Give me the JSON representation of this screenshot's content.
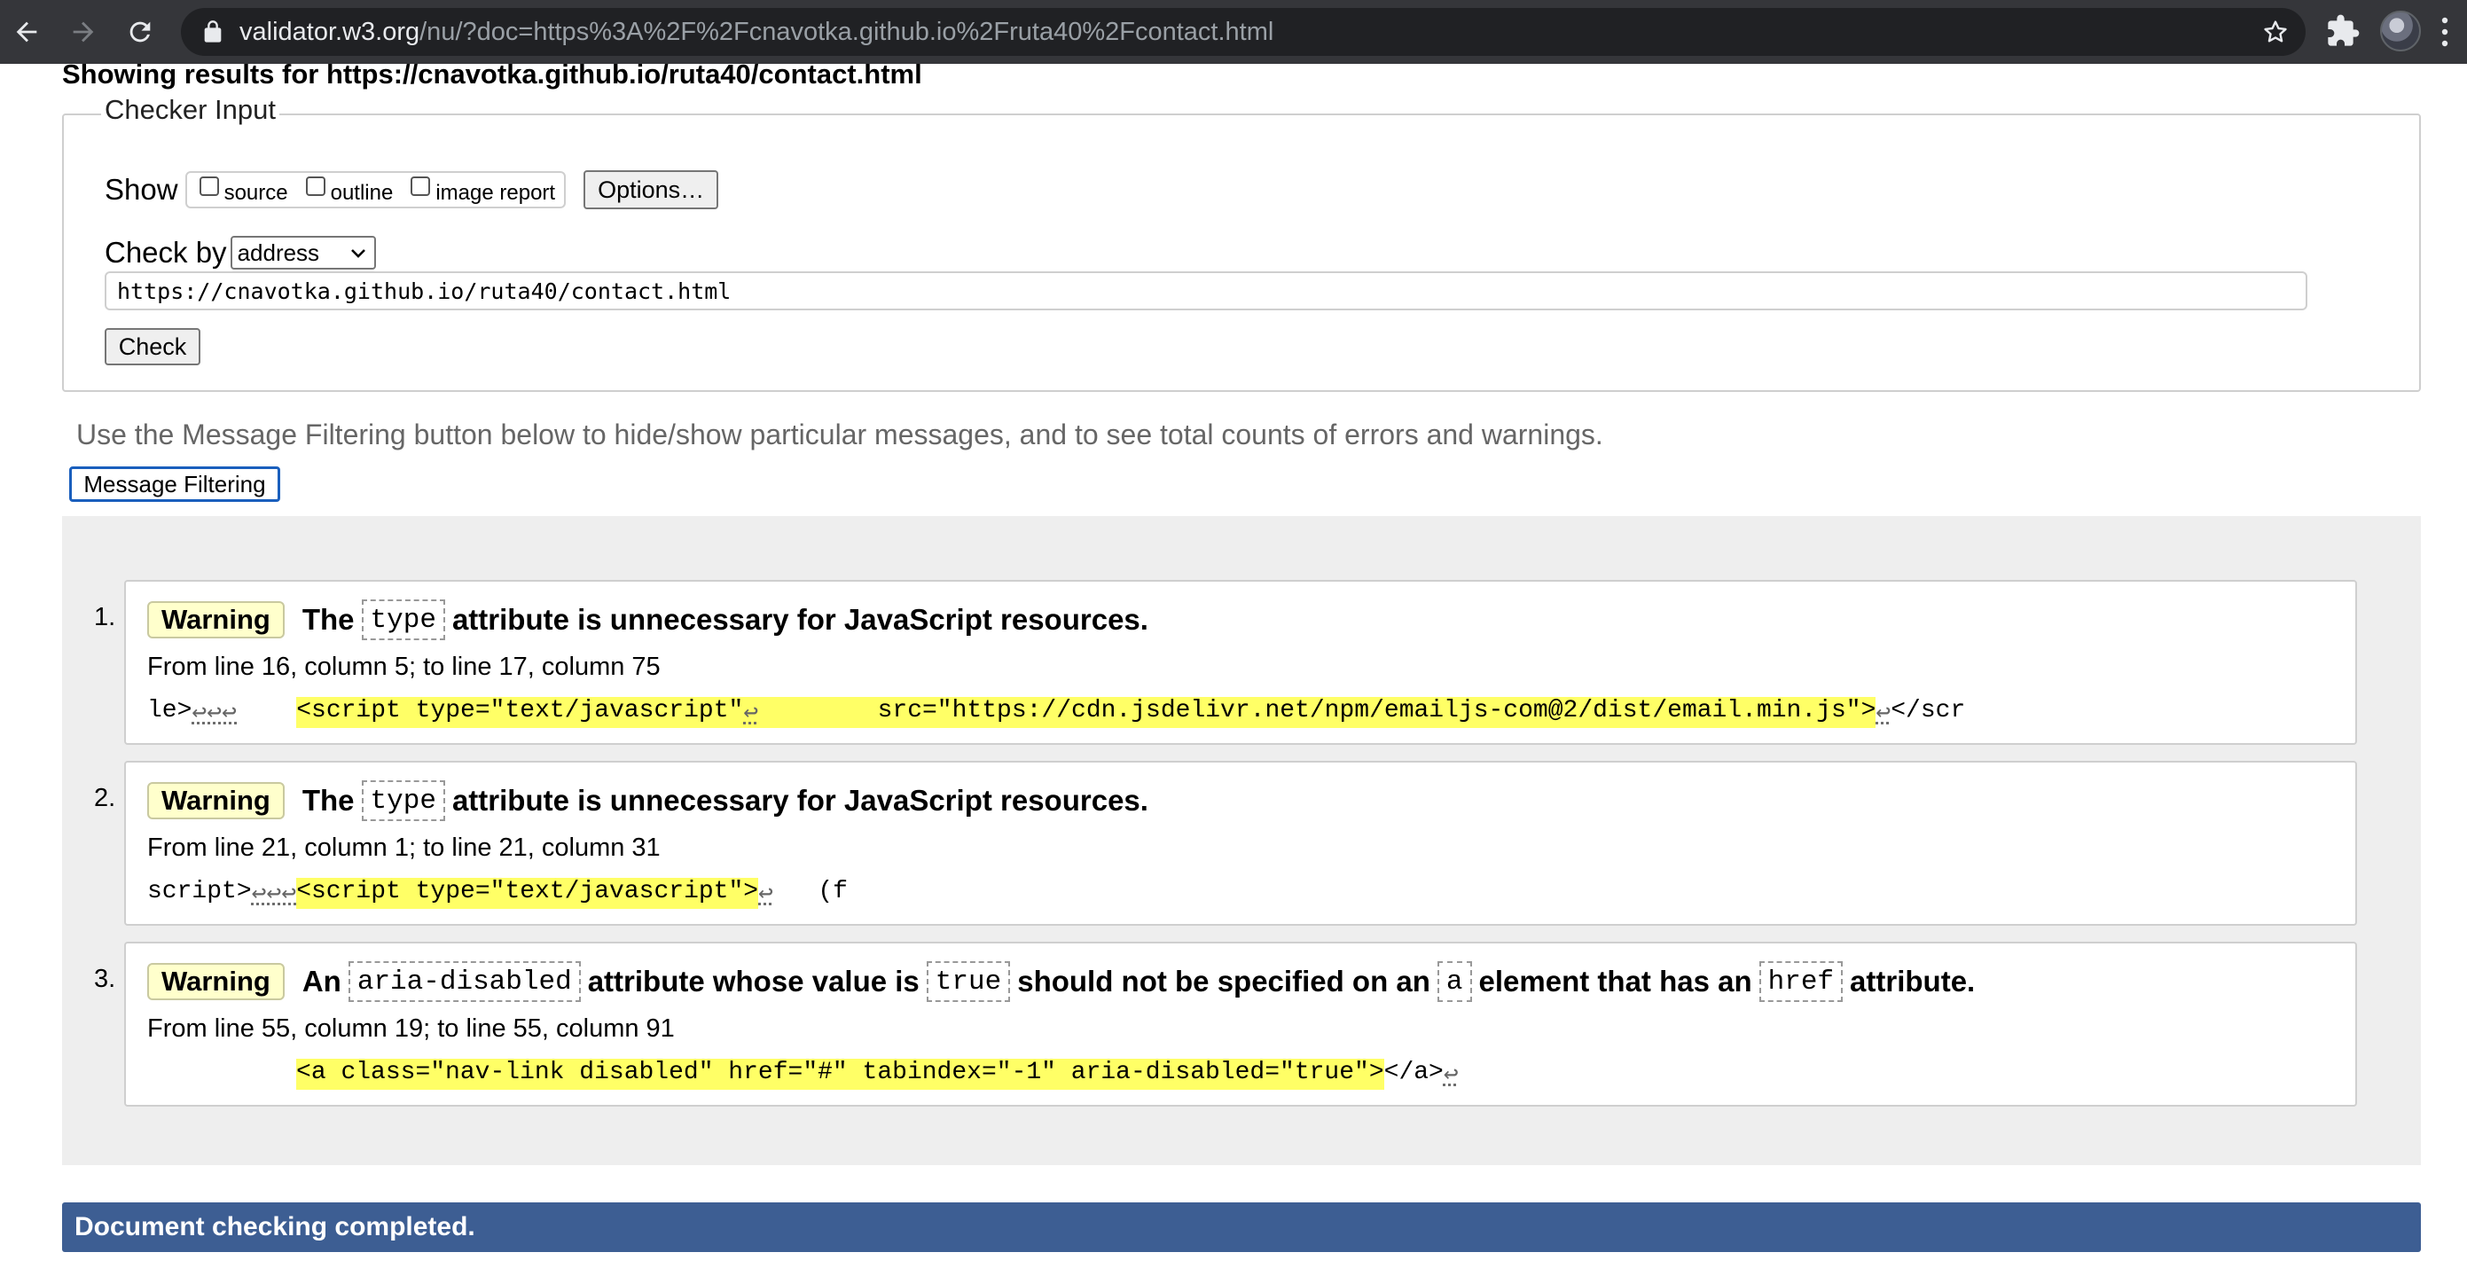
{
  "browser": {
    "url_host": "validator.w3.org",
    "url_rest": "/nu/?doc=https%3A%2F%2Fcnavotka.github.io%2Fruta40%2Fcontact.html"
  },
  "page": {
    "results_title": "Showing results for https://cnavotka.github.io/ruta40/contact.html"
  },
  "checker": {
    "legend": "Checker Input",
    "show_label": "Show",
    "checkbox_source": "source",
    "checkbox_outline": "outline",
    "checkbox_image_report": "image report",
    "options_button": "Options…",
    "check_by_label": "Check by",
    "check_by_value": "address",
    "url_value": "https://cnavotka.github.io/ruta40/contact.html",
    "check_button": "Check"
  },
  "filter": {
    "hint": "Use the Message Filtering button below to hide/show particular messages, and to see total counts of errors and warnings.",
    "button": "Message Filtering"
  },
  "messages": [
    {
      "num": "1.",
      "badge": "Warning",
      "t1": "The",
      "c1": "type",
      "t2": "attribute is unnecessary for JavaScript resources.",
      "location": "From line 16, column 5; to line 17, column 75",
      "pre": "le>",
      "pre_lf": "↩↩↩",
      "pre_space": "    ",
      "hl_a": "<script type=\"text/javascript\"",
      "hl_lf": "↩",
      "hl_b": "        src=\"https://cdn.jsdelivr.net/npm/emailjs-com@2/dist/email.min.js\">",
      "post_lf": "↩",
      "post": "</scr"
    },
    {
      "num": "2.",
      "badge": "Warning",
      "t1": "The",
      "c1": "type",
      "t2": "attribute is unnecessary for JavaScript resources.",
      "location": "From line 21, column 1; to line 21, column 31",
      "pre": "script>",
      "pre_lf": "↩↩↩",
      "hl_a": "<script type=\"text/javascript\">",
      "post_lf": "↩",
      "post": "   (f"
    },
    {
      "num": "3.",
      "badge": "Warning",
      "t1": "An",
      "c1": "aria-disabled",
      "t2": "attribute whose value is",
      "c2": "true",
      "t3": "should not be specified on an",
      "c3": "a",
      "t4": "element that has an",
      "c4": "href",
      "t5": "attribute.",
      "location": "From line 55, column 19; to line 55, column 91",
      "pre": "          ",
      "hl_a": "<a class=\"nav-link disabled\" href=\"#\" tabindex=\"-1\" aria-disabled=\"true\">",
      "post": "</a>",
      "post_lf": "↩"
    }
  ],
  "status": {
    "done": "Document checking completed."
  },
  "colors": {
    "toolbar": "#35363a",
    "omnibox": "#202124",
    "warning_badge": "#ffffcc",
    "highlight": "#ffff66",
    "status_bar": "#3d5e93"
  },
  "icons": [
    "back-icon",
    "forward-icon",
    "reload-icon",
    "lock-icon",
    "star-icon",
    "extensions-icon",
    "profile-avatar",
    "kebab-menu-icon"
  ]
}
